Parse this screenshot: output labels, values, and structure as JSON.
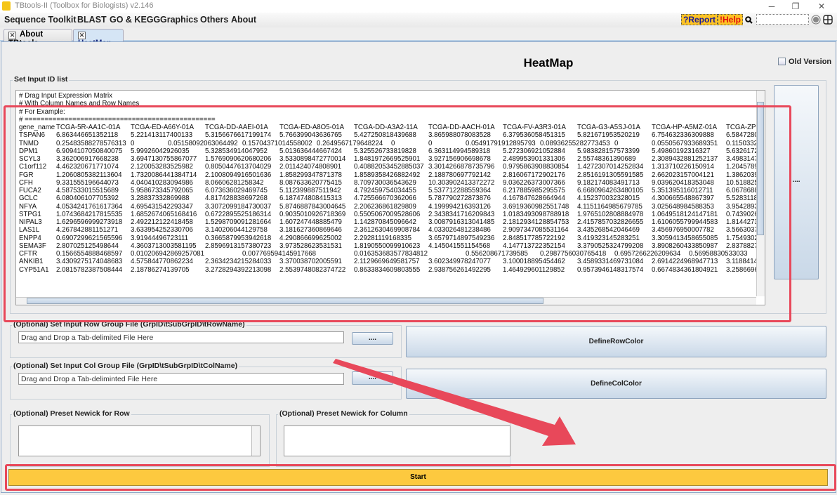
{
  "window": {
    "title": "TBtools-II (Toolbox for Biologists) v2.146",
    "minimize": "─",
    "maximize": "❐",
    "close": "✕"
  },
  "menu": [
    "Sequence Toolkit",
    "BLAST",
    "GO & KEGG",
    "Graphics",
    "Others",
    "About"
  ],
  "toolbar": {
    "report": "?Report",
    "help": "!Help",
    "search_icon": "search-icon",
    "search_value": ""
  },
  "tabs": [
    {
      "label": "About TBtools",
      "active": false
    },
    {
      "label": "HeatMap",
      "active": true
    }
  ],
  "tab_close": "✕",
  "page": {
    "title": "HeatMap",
    "old_version_label": "Old Version",
    "old_version_checked": false
  },
  "id_list": {
    "label": "Set Input ID list",
    "browse_label": "....",
    "comments": [
      "# Drag Input Expression Matrix",
      "# With Column Names and Row Names",
      "# For Example:",
      "# ================================================"
    ],
    "columns": [
      "gene_name",
      "TCGA-5R-AA1C-01A",
      "TCGA-ED-A66Y-01A",
      "TCGA-DD-AAEI-01A",
      "TCGA-ED-A8O5-01A",
      "TCGA-DD-A3A2-11A",
      "TCGA-DD-AACH-01A",
      "TCGA-FV-A3R3-01A",
      "TCGA-G3-A5SJ-01A",
      "TCGA-HP-A5MZ-01A",
      "TCGA-ZP-A"
    ],
    "rows": [
      {
        "name": "TSPAN6",
        "values": [
          "6.863446651352118",
          "5.221413117400133",
          "5.3156676617199174",
          "5.766399043636765",
          "5.427250818439688",
          "3.865988078083528",
          "6.379536058451315",
          "5.821671953520219",
          "6.754632336309888",
          "6.5847280"
        ]
      },
      {
        "name": "TNMD",
        "values": [
          "0.25483588278576313",
          "0",
          "0.05158092063064492",
          "0.15704371014558002",
          "0.2649567179648224",
          "0",
          "0",
          "0.05491791912895793",
          "0.08936255282773453",
          "0",
          "0.0550567933689351",
          "0.1150332"
        ]
      },
      {
        "name": "DPM1",
        "values": [
          "6.9094107050840075",
          "5.99926042926035",
          "5.328534914047952",
          "5.013636444667424",
          "5.325526733819828",
          "6.363114994589318",
          "5.272306921052884",
          "5.983828157573399",
          "5.49860192316327",
          "5.6326172"
        ]
      },
      {
        "name": "SCYL3",
        "values": [
          "3.362006917668238",
          "3.6947130755867077",
          "1.5769090620680206",
          "3.5330898472770014",
          "1.8481972669525901",
          "3.927156906698678",
          "2.489953901331306",
          "2.55748361390689",
          "2.3089432881252137",
          "3.4983147"
        ]
      },
      {
        "name": "C1orf112",
        "values": [
          "4.462320671771074",
          "2.120053283525982",
          "0.8050447613704029",
          "2.011424074808901",
          "0.40882053452885037",
          "3.3014266878735796",
          "0.9795863908830854",
          "1.4272307014252834",
          "1.313710226150914",
          "1.2045789"
        ]
      },
      {
        "name": "FGR",
        "values": [
          "1.2060805382113604",
          "1.7320086441384714",
          "2.1008094916501636",
          "1.858299347871378",
          "1.8589358426882492",
          "2.188780697792142",
          "2.816067172902176",
          "2.8516191305591585",
          "2.662023157004121",
          "1.3862039"
        ]
      },
      {
        "name": "CFH",
        "values": [
          "9.331555196644073",
          "4.040410283094986",
          "8.06606281258342",
          "8.087633620775415",
          "8.709730036543629",
          "10.303902413372272",
          "9.036226373007366",
          "9.182174083491713",
          "9.039620418353048",
          "10.518825"
        ]
      },
      {
        "name": "FUCA2",
        "values": [
          "4.587533015515689",
          "5.958673345792065",
          "6.073636029469745",
          "5.112399887511942",
          "4.792459754034455",
          "5.537712288559364",
          "6.217885985295575",
          "6.6680964263480105",
          "5.351395116012711",
          "6.0678688"
        ]
      },
      {
        "name": "GCLC",
        "values": [
          "6.080406107705392",
          "3.28837332869988",
          "4.817428838697268",
          "6.187474808415313",
          "4.725566670362066",
          "5.787790272873876",
          "4.167847628664944",
          "4.152370032328015",
          "4.300665548867397",
          "5.5283118"
        ]
      },
      {
        "name": "NFYA",
        "values": [
          "4.0534241761617364",
          "4.695431542293347",
          "3.3072099184730037",
          "5.8746887843004645",
          "2.206236861829809",
          "4.199994216393126",
          "3.6919360982551748",
          "4.1151164985679785",
          "3.025648984588353",
          "3.9542893"
        ]
      },
      {
        "name": "STPG1",
        "values": [
          "1.0743684217815535",
          "1.6852674065168416",
          "0.6722895525186314",
          "0.9035010926718369",
          "0.5505067009528606",
          "2.3438341716209843",
          "1.0183493098788918",
          "1.9765102808884978",
          "1.0649518124147181",
          "0.7439026"
        ]
      },
      {
        "name": "NIPAL3",
        "values": [
          "1.6296596999273918",
          "2.492212122418458",
          "1.5298709091281664",
          "1.607247448885479",
          "1.142870845096642",
          "3.0087916313041485",
          "2.1812934128854753",
          "2.4157857032826655",
          "1.6106055799944583",
          "1.8144273"
        ]
      },
      {
        "name": "LAS1L",
        "values": [
          "4.267842881151271",
          "3.633954252330706",
          "3.140206044129758",
          "3.181627360869646",
          "2.3612630469908784",
          "4.033026481238486",
          "2.9097347085531164",
          "3.435268542046469",
          "3.456976950007782",
          "3.5663037"
        ]
      },
      {
        "name": "ENPP4",
        "values": [
          "0.6907299621565596",
          "3.91944496723111",
          "0.3665879953942618",
          "4.290866699625002",
          "2.29281119168335",
          "3.6579714897549236",
          "2.848517785722192",
          "3.419323145283251",
          "3.3059413458655085",
          "1.7549302"
        ]
      },
      {
        "name": "SEMA3F",
        "values": [
          "2.807025125498644",
          "4.3603713003581195",
          "2.8596913157380723",
          "3.973528623531531",
          "1.8190550099910623",
          "4.145041551154568",
          "4.147713722352154",
          "3.3790525324799208",
          "3.8908260433850987",
          "2.8378827"
        ]
      },
      {
        "name": "CFTR",
        "values": [
          "0.1566554888468597",
          "0.010206942869257081",
          "0.007769594145917668",
          "0.016353683577834812",
          "0.556208671739585",
          "0.2987756030765418",
          "0.6957266226209634",
          "0.56958830533033",
          "0.1920678844796504",
          "0.0644690"
        ]
      },
      {
        "name": "ANKIB1",
        "values": [
          "3.4309275174048683",
          "4.575844770862234",
          "2.3634234215284033",
          "3.370038702005591",
          "2.1129669649581757",
          "3.602349978247077",
          "3.100018895454462",
          "3.4589331469731084",
          "2.6914224968947713",
          "3.1188414"
        ]
      },
      {
        "name": "CYP51A1",
        "values": [
          "2.0815782387508444",
          "2.18786274139705",
          "3.2728294392213098",
          "2.5539748082374722",
          "0.8633834609803555",
          "2.938756261492295",
          "1.464929601129852",
          "0.9573946148317574",
          "0.6674834361804921",
          "3.2586696"
        ]
      }
    ]
  },
  "row_group": {
    "label": "(Optional) Set Input Row Group File (GrpID\\tSubGrpID\\tRowName)",
    "placeholder": "Drag and Drop a Tab-delimited File Here",
    "browse_label": "....",
    "define_label": "DefineRowColor"
  },
  "col_group": {
    "label": "(Optional) Set Input Col Group File (GrpID\\tSubGrpID\\tColName)",
    "placeholder": "Drag and Drop a Tab-deliminted File Here",
    "browse_label": "....",
    "define_label": "DefineColColor"
  },
  "newick_row": {
    "label": "(Optional) Preset Newick for Row",
    "value": ""
  },
  "newick_col": {
    "label": "(Optional) Preset Newick for Column",
    "value": ""
  },
  "start_label": "Start",
  "colors": {
    "accent_yellow": "#fdc93f",
    "annotation_red": "#e8485a",
    "tab_active": "#d5e5f5"
  }
}
